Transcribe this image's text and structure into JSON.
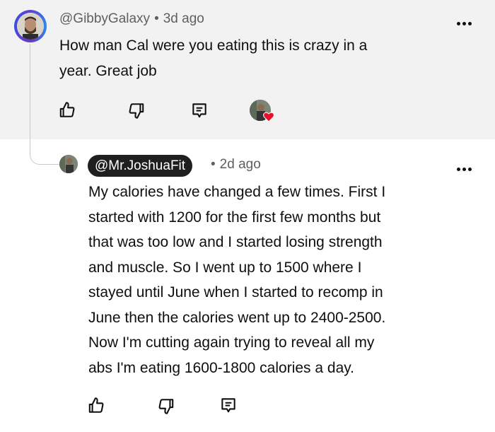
{
  "parent_comment": {
    "handle": "@GibbyGalaxy",
    "separator": "•",
    "time": "3d ago",
    "text_lines": [
      "How man Cal were you eating this is crazy in a",
      "year. Great job"
    ],
    "actions": {
      "like_icon": "thumbs-up-icon",
      "dislike_icon": "thumbs-down-icon",
      "reply_icon": "reply-icon",
      "creator_heart_icon": "heart-icon"
    }
  },
  "reply_comment": {
    "handle": "@Mr.JoshuaFit",
    "separator": "•",
    "time": "2d ago",
    "text_lines": [
      "My calories have changed a few times. First I",
      "started with 1200 for the first few months but",
      "that was too low and I started losing strength",
      "and muscle. So I went up to 1500 where I",
      "stayed until June when I started to recomp in",
      "June then the calories went up to 2400-2500.",
      "Now I'm cutting again trying to reveal all my",
      "abs I'm eating 1600-1800 calories a day."
    ],
    "actions": {
      "like_icon": "thumbs-up-icon",
      "dislike_icon": "thumbs-down-icon",
      "reply_icon": "reply-icon"
    }
  },
  "colors": {
    "parent_background": "#f2f2f2",
    "heart": "#e8112d",
    "badge_background": "#1f1f1f"
  }
}
